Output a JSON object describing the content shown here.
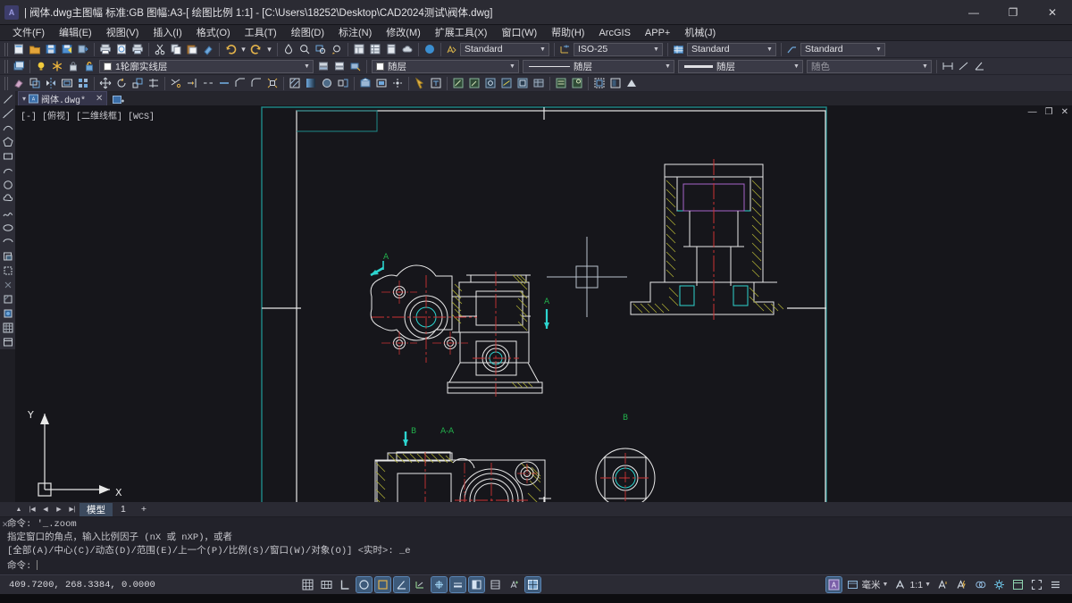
{
  "window": {
    "title": "| 阀体.dwg主图幅 标准:GB 图幅:A3-[ 绘图比例 1:1] - [C:\\Users\\18252\\Desktop\\CAD2024测试\\阀体.dwg]",
    "app_logo_glyph": "A",
    "minimize_glyph": "—",
    "maximize_glyph": "❐",
    "close_glyph": "✕"
  },
  "menubar": {
    "items": [
      {
        "label": "文件(F)",
        "name": "menu-file"
      },
      {
        "label": "编辑(E)",
        "name": "menu-edit"
      },
      {
        "label": "视图(V)",
        "name": "menu-view"
      },
      {
        "label": "插入(I)",
        "name": "menu-insert"
      },
      {
        "label": "格式(O)",
        "name": "menu-format"
      },
      {
        "label": "工具(T)",
        "name": "menu-tools"
      },
      {
        "label": "绘图(D)",
        "name": "menu-draw"
      },
      {
        "label": "标注(N)",
        "name": "menu-dimension"
      },
      {
        "label": "修改(M)",
        "name": "menu-modify"
      },
      {
        "label": "扩展工具(X)",
        "name": "menu-express"
      },
      {
        "label": "窗口(W)",
        "name": "menu-window"
      },
      {
        "label": "帮助(H)",
        "name": "menu-help"
      },
      {
        "label": "ArcGIS",
        "name": "menu-arcgis"
      },
      {
        "label": "APP+",
        "name": "menu-appplus"
      },
      {
        "label": "机械(J)",
        "name": "menu-mechanical"
      }
    ]
  },
  "toolbar_styles": {
    "text_style": "Standard",
    "dim_style": "ISO-25",
    "table_style": "Standard",
    "mleader_style": "Standard"
  },
  "layer_bar": {
    "current_layer": "1轮廓实线层",
    "color": "随层",
    "linetype": "随层",
    "lineweight": "随层",
    "plotstyle": "随色"
  },
  "doctab": {
    "filename": "阀体.dwg*",
    "close_glyph": "✕",
    "dropdown_glyph": "▾"
  },
  "viewport": {
    "label": "[-] [俯视] [二维线框] [WCS]",
    "minimize_glyph": "—",
    "restore_glyph": "❐",
    "close_glyph": "✕"
  },
  "drawing": {
    "view_labels": [
      {
        "text": "A",
        "name": "section-marker-a-top-left"
      },
      {
        "text": "A",
        "name": "section-marker-a-right"
      },
      {
        "text": "B",
        "name": "detail-marker-b-left"
      },
      {
        "text": "A-A",
        "name": "section-view-title-aa"
      },
      {
        "text": "B",
        "name": "detail-view-title-b"
      }
    ],
    "ucs": {
      "x_label": "X",
      "y_label": "Y"
    }
  },
  "modeltabs": {
    "first_glyph": "|◀",
    "prev_glyph": "◀",
    "next_glyph": "▶",
    "last_glyph": "▶|",
    "collapse_glyph": "▲",
    "tabs": [
      {
        "label": "模型",
        "active": true
      },
      {
        "label": "1",
        "active": false
      }
    ],
    "add_glyph": "+"
  },
  "command_line": {
    "history": [
      "命令: '_.zoom",
      "指定窗口的角点，输入比例因子 (nX 或 nXP)，或者",
      "[全部(A)/中心(C)/动态(D)/范围(E)/上一个(P)/比例(S)/窗口(W)/对象(O)] <实时>: _e"
    ],
    "prompt": "命令:",
    "input_value": "",
    "close_glyph": "✕"
  },
  "statusbar": {
    "coordinates": "409.7200,  268.3384,  0.0000",
    "units": "毫米",
    "annotation_scale": "1:1",
    "left_icons": [
      {
        "name": "grid-display-icon",
        "glyph": "▦",
        "on": false
      },
      {
        "name": "snap-mode-icon",
        "glyph": "▩",
        "on": false
      },
      {
        "name": "ortho-mode-icon",
        "glyph": "∟",
        "on": false
      },
      {
        "name": "polar-tracking-icon",
        "glyph": "◯",
        "on": true
      },
      {
        "name": "object-snap-icon",
        "glyph": "⬚",
        "on": true
      },
      {
        "name": "object-snap-tracking-icon",
        "glyph": "∠",
        "on": true
      },
      {
        "name": "dynamic-ucs-icon",
        "glyph": "⊾",
        "on": false
      },
      {
        "name": "dynamic-input-icon",
        "glyph": "⊹",
        "on": true
      },
      {
        "name": "lineweight-icon",
        "glyph": "═",
        "on": true
      },
      {
        "name": "transparency-icon",
        "glyph": "◧",
        "on": true
      },
      {
        "name": "selection-cycling-icon",
        "glyph": "▤",
        "on": false
      },
      {
        "name": "annotation-monitor-icon",
        "glyph": "⁺ₐ",
        "on": false
      },
      {
        "name": "workspace-switch-icon",
        "glyph": "▧",
        "on": true
      }
    ],
    "right_icons": [
      {
        "name": "model-space-icon",
        "glyph": "A"
      },
      {
        "name": "viewport-scale-icon",
        "glyph": "▤"
      },
      {
        "name": "annotation-visibility-icon",
        "glyph": "🗚"
      },
      {
        "name": "auto-scale-icon",
        "glyph": "🗛"
      },
      {
        "name": "isolate-objects-icon",
        "glyph": "⬡"
      },
      {
        "name": "hardware-accel-icon",
        "glyph": "✷"
      },
      {
        "name": "clean-screen-icon",
        "glyph": "⊞"
      },
      {
        "name": "fullscreen-icon",
        "glyph": "⛶"
      },
      {
        "name": "customization-menu-icon",
        "glyph": "☰"
      }
    ]
  }
}
